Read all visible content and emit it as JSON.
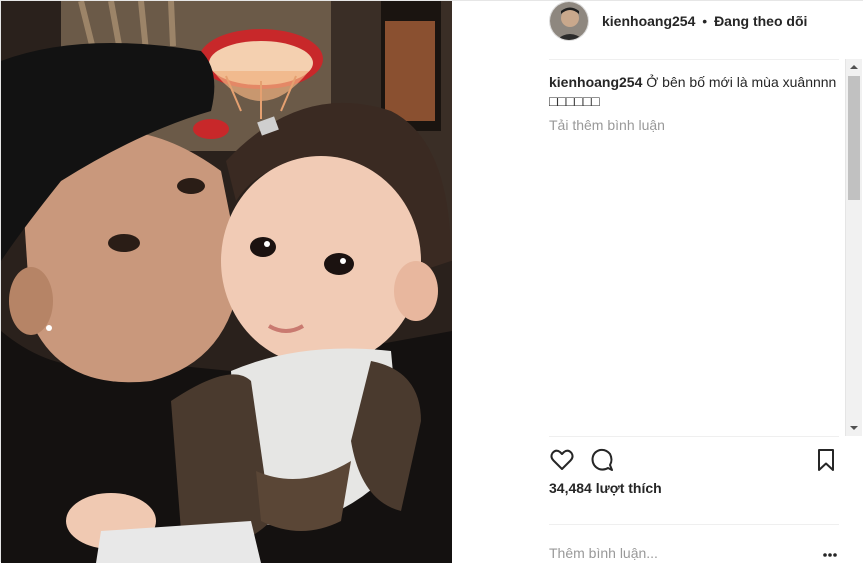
{
  "post": {
    "username": "kienhoang254",
    "separator": "•",
    "follow_status": "Đang theo dõi",
    "caption_user": "kienhoang254",
    "caption_text": "Ở bên bố mới là mùa xuânnnn □□□□□□",
    "load_more": "Tải thêm bình luận",
    "likes": "34,484 lượt thích",
    "add_comment_placeholder": "Thêm bình luận..."
  },
  "icons": {
    "like": "heart-icon",
    "comment": "comment-bubble-icon",
    "save": "bookmark-icon",
    "more": "more-options-icon"
  },
  "colors": {
    "text": "#262626",
    "muted": "#999999",
    "divider": "#efefef",
    "lamp": "#c8282a"
  }
}
